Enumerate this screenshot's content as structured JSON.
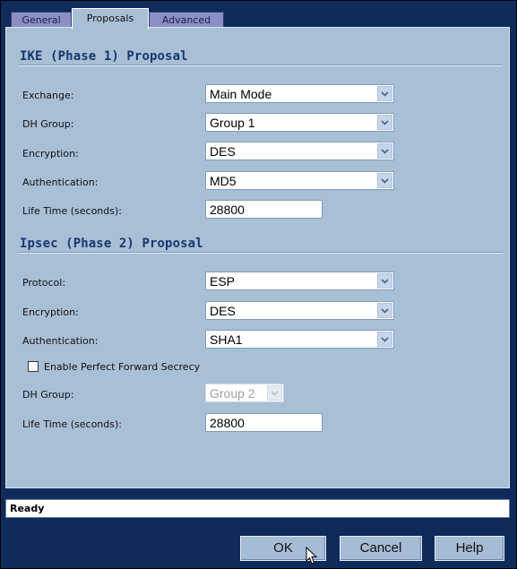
{
  "tabs": [
    {
      "label": "General"
    },
    {
      "label": "Proposals",
      "active": true
    },
    {
      "label": "Advanced"
    }
  ],
  "phase1": {
    "title": "IKE (Phase 1) Proposal",
    "exchange": {
      "label": "Exchange:",
      "value": "Main Mode"
    },
    "dh_group": {
      "label": "DH Group:",
      "value": "Group 1"
    },
    "encryption": {
      "label": "Encryption:",
      "value": "DES"
    },
    "authentication": {
      "label": "Authentication:",
      "value": "MD5"
    },
    "lifetime": {
      "label": "Life Time (seconds):",
      "value": "28800"
    }
  },
  "phase2": {
    "title": "Ipsec (Phase 2) Proposal",
    "protocol": {
      "label": "Protocol:",
      "value": "ESP"
    },
    "encryption": {
      "label": "Encryption:",
      "value": "DES"
    },
    "authentication": {
      "label": "Authentication:",
      "value": "SHA1"
    },
    "pfs": {
      "label": "Enable Perfect Forward Secrecy",
      "checked": false
    },
    "dh_group": {
      "label": "DH Group:",
      "value": "Group 2",
      "disabled": true
    },
    "lifetime": {
      "label": "Life Time (seconds):",
      "value": "28800"
    }
  },
  "status": {
    "text": "Ready"
  },
  "buttons": {
    "ok": "OK",
    "cancel": "Cancel",
    "help": "Help"
  },
  "icons": {
    "dropdown": "chevron-down-icon",
    "pointer": "mouse-pointer-icon"
  },
  "colors": {
    "frame": "#0f2b5a",
    "panel": "#a9bfd6",
    "tab_inactive": "#8c8fc5",
    "section_title": "#18386e"
  }
}
